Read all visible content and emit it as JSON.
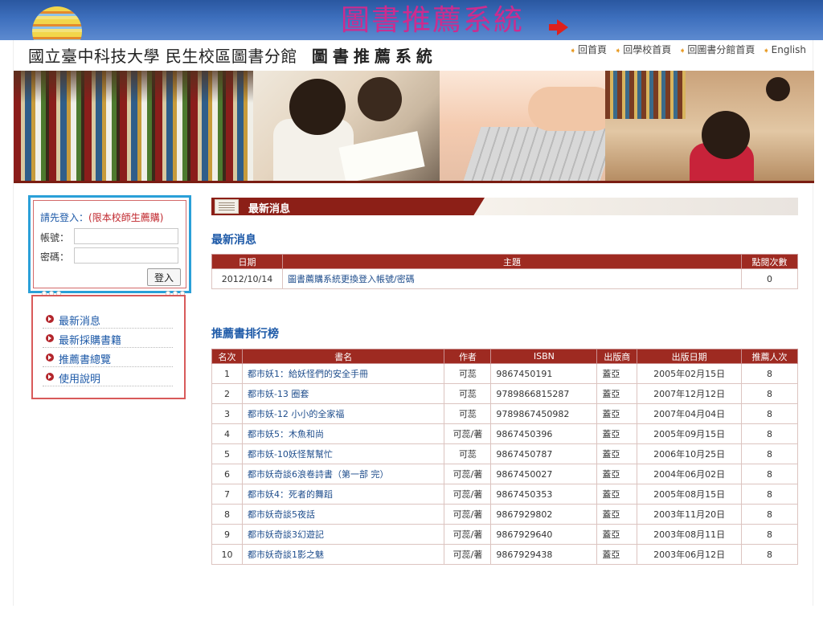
{
  "slide": {
    "title": "圖書推薦系統"
  },
  "header": {
    "site_name": "國立臺中科技大學 民生校區圖書分館",
    "system_name": "圖書推薦系統",
    "links": [
      "回首頁",
      "回學校首頁",
      "回圖書分館首頁",
      "English"
    ]
  },
  "login": {
    "prompt": "請先登入：",
    "restriction": "(限本校師生薦購)",
    "account_label": "帳號：",
    "account_value": "",
    "password_label": "密碼：",
    "password_value": "",
    "login_button": "登入"
  },
  "menu": {
    "items": [
      "最新消息",
      "最新採購書籍",
      "推薦書總覽",
      "使用說明"
    ]
  },
  "news_bar": {
    "title": "最新消息"
  },
  "news": {
    "section_title": "最新消息",
    "headers": [
      "日期",
      "主題",
      "點閱次數"
    ],
    "rows": [
      {
        "date": "2012/10/14",
        "topic": "圖書薦購系統更換登入帳號/密碼",
        "views": "0"
      }
    ]
  },
  "ranking": {
    "section_title": "推薦書排行榜",
    "headers": [
      "名次",
      "書名",
      "作者",
      "ISBN",
      "出版商",
      "出版日期",
      "推薦人次"
    ],
    "rows": [
      {
        "rank": "1",
        "title": "都市妖1：給妖怪們的安全手冊",
        "author": "可蕊",
        "isbn": "9867450191",
        "publisher": "蓋亞",
        "date": "2005年02月15日",
        "count": "8"
      },
      {
        "rank": "2",
        "title": "都市妖-13 圈套",
        "author": "可蕊",
        "isbn": "9789866815287",
        "publisher": "蓋亞",
        "date": "2007年12月12日",
        "count": "8"
      },
      {
        "rank": "3",
        "title": "都市妖-12 小小的全家福",
        "author": "可蕊",
        "isbn": "9789867450982",
        "publisher": "蓋亞",
        "date": "2007年04月04日",
        "count": "8"
      },
      {
        "rank": "4",
        "title": "都市妖5：木魚和尚",
        "author": "可蕊/著",
        "isbn": "9867450396",
        "publisher": "蓋亞",
        "date": "2005年09月15日",
        "count": "8"
      },
      {
        "rank": "5",
        "title": "都市妖-10妖怪幫幫忙",
        "author": "可蕊",
        "isbn": "9867450787",
        "publisher": "蓋亞",
        "date": "2006年10月25日",
        "count": "8"
      },
      {
        "rank": "6",
        "title": "都市妖奇談6浪卷詩書（第一部 完）",
        "author": "可蕊/著",
        "isbn": "9867450027",
        "publisher": "蓋亞",
        "date": "2004年06月02日",
        "count": "8"
      },
      {
        "rank": "7",
        "title": "都市妖4：死者的舞蹈",
        "author": "可蕊/著",
        "isbn": "9867450353",
        "publisher": "蓋亞",
        "date": "2005年08月15日",
        "count": "8"
      },
      {
        "rank": "8",
        "title": "都市妖奇談5夜話",
        "author": "可蕊/著",
        "isbn": "9867929802",
        "publisher": "蓋亞",
        "date": "2003年11月20日",
        "count": "8"
      },
      {
        "rank": "9",
        "title": "都市妖奇談3幻遊記",
        "author": "可蕊/著",
        "isbn": "9867929640",
        "publisher": "蓋亞",
        "date": "2003年08月11日",
        "count": "8"
      },
      {
        "rank": "10",
        "title": "都市妖奇談1影之魅",
        "author": "可蕊/著",
        "isbn": "9867929438",
        "publisher": "蓋亞",
        "date": "2003年06月12日",
        "count": "8"
      }
    ]
  },
  "colors": {
    "slide_title": "#cc2c8f",
    "table_header": "#9e2a21",
    "link_blue": "#1e5aa8",
    "login_highlight": "#2aa0d8"
  },
  "icons": [
    "balloon-icon",
    "red-arrow-icon",
    "link-arrow-icon",
    "bullet-arrow-icon",
    "news-icon"
  ]
}
